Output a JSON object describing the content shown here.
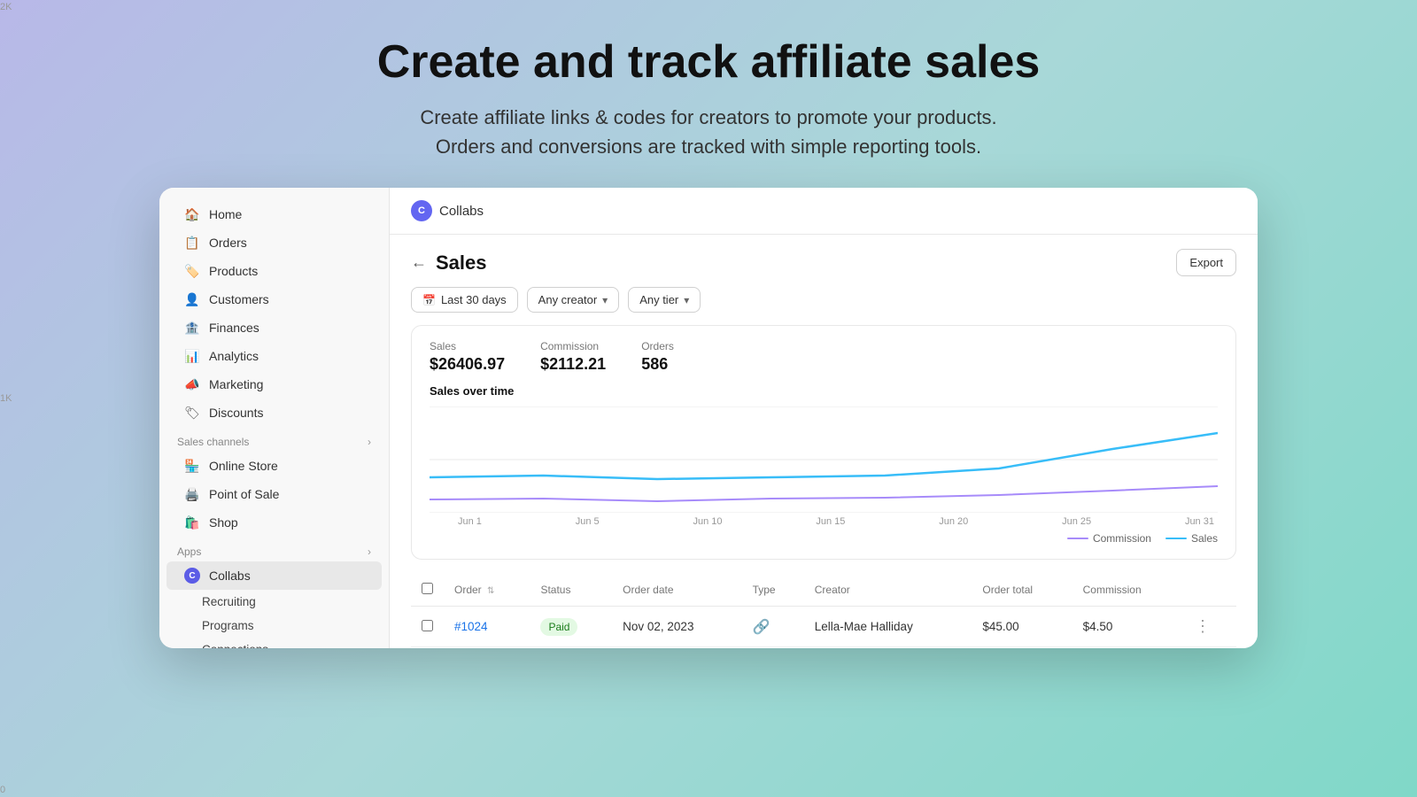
{
  "hero": {
    "title": "Create and track affiliate sales",
    "subtitle_line1": "Create affiliate links & codes for creators to promote your products.",
    "subtitle_line2": "Orders and conversions are tracked with simple reporting tools."
  },
  "sidebar": {
    "main_items": [
      {
        "id": "home",
        "label": "Home",
        "icon": "home"
      },
      {
        "id": "orders",
        "label": "Orders",
        "icon": "orders"
      },
      {
        "id": "products",
        "label": "Products",
        "icon": "products"
      },
      {
        "id": "customers",
        "label": "Customers",
        "icon": "customers"
      },
      {
        "id": "finances",
        "label": "Finances",
        "icon": "finances"
      },
      {
        "id": "analytics",
        "label": "Analytics",
        "icon": "analytics"
      },
      {
        "id": "marketing",
        "label": "Marketing",
        "icon": "marketing"
      },
      {
        "id": "discounts",
        "label": "Discounts",
        "icon": "discounts"
      }
    ],
    "sales_channels_label": "Sales channels",
    "sales_channels": [
      {
        "id": "online-store",
        "label": "Online Store",
        "icon": "store"
      },
      {
        "id": "point-of-sale",
        "label": "Point of Sale",
        "icon": "pos"
      },
      {
        "id": "shop",
        "label": "Shop",
        "icon": "shop"
      }
    ],
    "apps_label": "Apps",
    "apps_items": [
      {
        "id": "collabs",
        "label": "Collabs",
        "icon": "collabs"
      }
    ],
    "sub_items": [
      {
        "id": "recruiting",
        "label": "Recruiting"
      },
      {
        "id": "programs",
        "label": "Programs"
      },
      {
        "id": "connections",
        "label": "Connections"
      }
    ]
  },
  "topbar": {
    "icon_text": "C",
    "title": "Collabs"
  },
  "page": {
    "title": "Sales",
    "export_label": "Export"
  },
  "filters": {
    "date_range": "Last 30 days",
    "creator": "Any creator",
    "tier": "Any tier"
  },
  "stats": {
    "sales_label": "Sales",
    "sales_value": "$26406.97",
    "commission_label": "Commission",
    "commission_value": "$2112.21",
    "orders_label": "Orders",
    "orders_value": "586",
    "chart_title": "Sales over time"
  },
  "chart": {
    "y_labels": [
      "2K",
      "1K",
      "0"
    ],
    "x_labels": [
      "Jun 1",
      "Jun 5",
      "Jun 10",
      "Jun 15",
      "Jun 20",
      "Jun 25",
      "Jun 31"
    ],
    "legend": [
      {
        "label": "Commission",
        "color": "#a78bfa"
      },
      {
        "label": "Sales",
        "color": "#38bdf8"
      }
    ]
  },
  "table": {
    "columns": [
      "",
      "Order",
      "Status",
      "Order date",
      "Type",
      "Creator",
      "Order total",
      "Commission",
      ""
    ],
    "rows": [
      {
        "id": "1024",
        "order": "#1024",
        "status": "Paid",
        "status_type": "paid",
        "order_date": "Nov 02, 2023",
        "type_icon": "link",
        "creator": "Lella-Mae Halliday",
        "order_total": "$45.00",
        "commission": "$4.50"
      }
    ]
  }
}
